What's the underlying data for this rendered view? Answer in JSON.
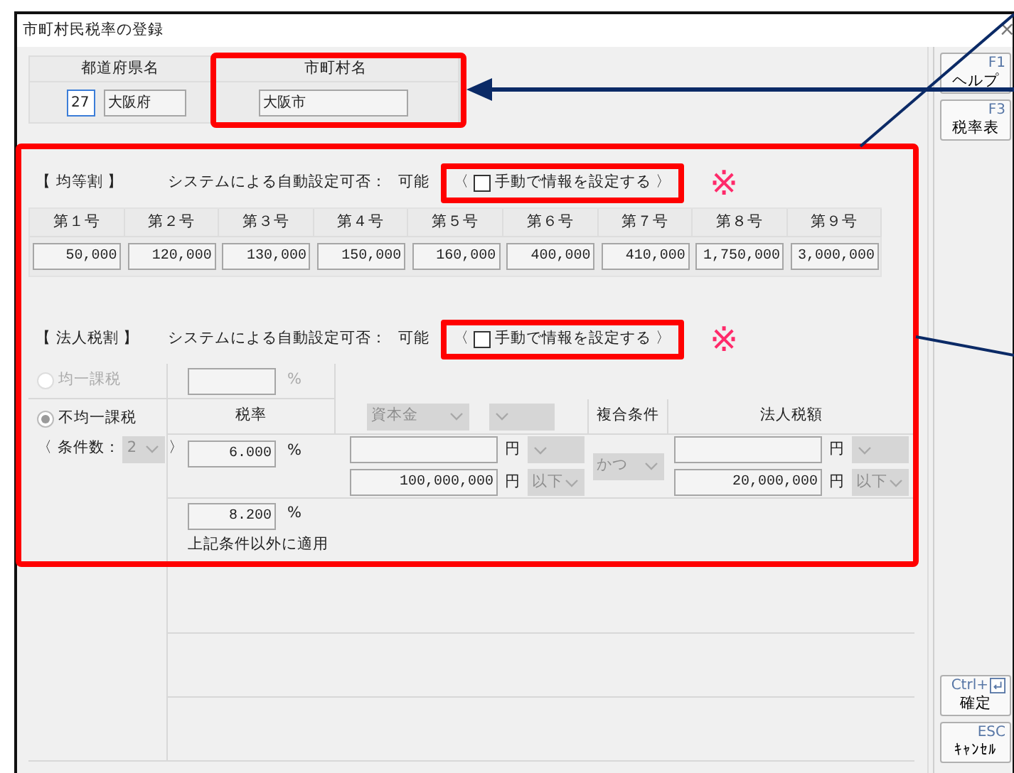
{
  "window": {
    "title": "市町村民税率の登録",
    "close": "×"
  },
  "location": {
    "columns": [
      "都道府県名",
      "市町村名"
    ],
    "prefecture_code": "27",
    "prefecture": "大阪府",
    "municipality": "大阪市"
  },
  "sections": [
    {
      "title": "【 均等割 】",
      "auto_label": "システムによる自動設定可否：",
      "auto_value": "可能",
      "open": "〈",
      "manual_checked": false,
      "manual_label": "手動で情報を設定する",
      "close": "〉",
      "note_mark": "※"
    },
    {
      "title": "【 法人税割 】",
      "auto_label": "システムによる自動設定可否：",
      "auto_value": "可能",
      "open": "〈",
      "manual_checked": false,
      "manual_label": "手動で情報を設定する",
      "close": "〉",
      "note_mark": "※"
    }
  ],
  "per_capita": {
    "columns": [
      "第１号",
      "第２号",
      "第３号",
      "第４号",
      "第５号",
      "第６号",
      "第７号",
      "第８号",
      "第９号"
    ],
    "values": [
      "50,000",
      "120,000",
      "130,000",
      "150,000",
      "160,000",
      "400,000",
      "410,000",
      "1,750,000",
      "3,000,000"
    ]
  },
  "corporate": {
    "methods": [
      {
        "label": "均一課税",
        "selected": false,
        "disabled": true
      },
      {
        "label": "不均一課税",
        "selected": true,
        "disabled": false
      }
    ],
    "uniform_unit": "%",
    "condition_count": {
      "label": "〈 条件数：",
      "value": "2",
      "close": "〉"
    },
    "headers": {
      "rate": "税率",
      "basis": "資本金",
      "combine": "複合条件",
      "amount": "法人税額"
    },
    "rows": [
      {
        "kind": "range",
        "rate": "6.000",
        "rate_unit": "%",
        "capital_unit_1": "円",
        "capital_value_2": "100,000,000",
        "capital_unit_2": "円",
        "capital_op_2": "以下",
        "combine": "かつ",
        "amount_unit_1": "円",
        "amount_value_2": "20,000,000",
        "amount_unit_2": "円",
        "amount_op_2": "以下"
      },
      {
        "kind": "default",
        "rate": "8.200",
        "rate_unit": "%",
        "note": "上記条件以外に適用"
      }
    ]
  },
  "sidebar": {
    "top": [
      {
        "key": "F1",
        "label": "ヘルプ"
      },
      {
        "key": "F3",
        "label": "税率表"
      }
    ],
    "bottom": [
      {
        "key": "Ctrl+",
        "enter_icon": true,
        "label": "確定"
      },
      {
        "key": "ESC",
        "label": "ｷｬﾝｾﾙ"
      }
    ]
  }
}
